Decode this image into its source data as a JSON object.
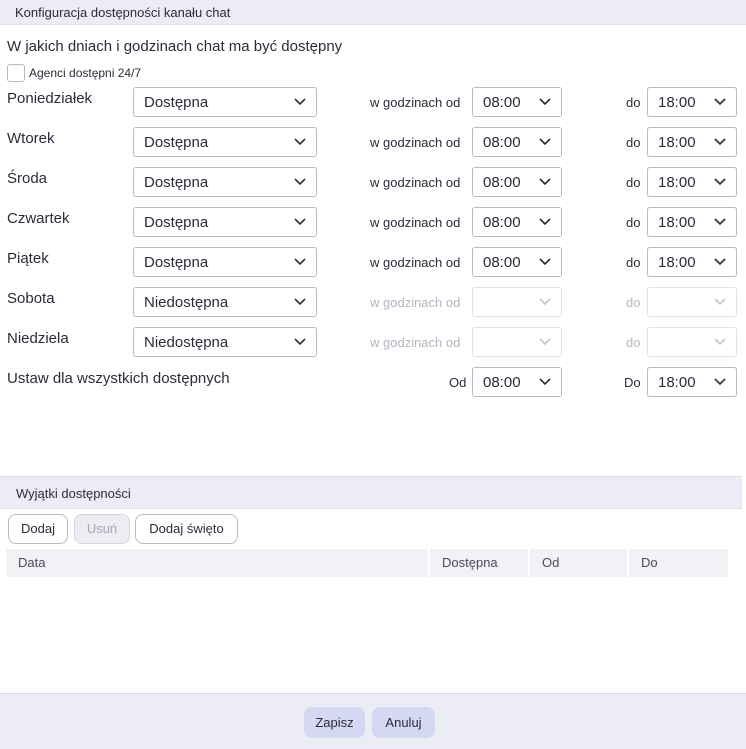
{
  "window": {
    "title": "Konfiguracja dostępności kanału chat"
  },
  "section": {
    "subtitle": "W jakich dniach i godzinach chat ma być dostępny"
  },
  "agents247": {
    "label": "Agenci dostępni 24/7",
    "checked": false
  },
  "days": [
    {
      "name": "Poniedziałek",
      "status": "Dostępna",
      "from_label": "w godzinach od",
      "from": "08:00",
      "to_label": "do",
      "to": "18:00",
      "enabled": true
    },
    {
      "name": "Wtorek",
      "status": "Dostępna",
      "from_label": "w godzinach od",
      "from": "08:00",
      "to_label": "do",
      "to": "18:00",
      "enabled": true
    },
    {
      "name": "Środa",
      "status": "Dostępna",
      "from_label": "w godzinach od",
      "from": "08:00",
      "to_label": "do",
      "to": "18:00",
      "enabled": true
    },
    {
      "name": "Czwartek",
      "status": "Dostępna",
      "from_label": "w godzinach od",
      "from": "08:00",
      "to_label": "do",
      "to": "18:00",
      "enabled": true
    },
    {
      "name": "Piątek",
      "status": "Dostępna",
      "from_label": "w godzinach od",
      "from": "08:00",
      "to_label": "do",
      "to": "18:00",
      "enabled": true
    },
    {
      "name": "Sobota",
      "status": "Niedostępna",
      "from_label": "w godzinach od",
      "from": "",
      "to_label": "do",
      "to": "",
      "enabled": false
    },
    {
      "name": "Niedziela",
      "status": "Niedostępna",
      "from_label": "w godzinach od",
      "from": "",
      "to_label": "do",
      "to": "",
      "enabled": false
    }
  ],
  "set_all": {
    "label": "Ustaw dla wszystkich dostępnych",
    "from_label": "Od",
    "from": "08:00",
    "to_label": "Do",
    "to": "18:00"
  },
  "exceptions": {
    "title": "Wyjątki dostępności",
    "buttons": {
      "add": "Dodaj",
      "remove": "Usuń",
      "add_holiday": "Dodaj święto"
    },
    "columns": [
      "Data",
      "Dostępna",
      "Od",
      "Do"
    ]
  },
  "footer": {
    "save": "Zapisz",
    "cancel": "Anuluj"
  },
  "colors": {
    "header_bg": "#ececf5",
    "primary_button": "#d5d8f3",
    "border": "#b9b9c9",
    "muted_text": "#b4b4c2"
  },
  "icons": {
    "dropdown": "chevron-down-icon"
  }
}
